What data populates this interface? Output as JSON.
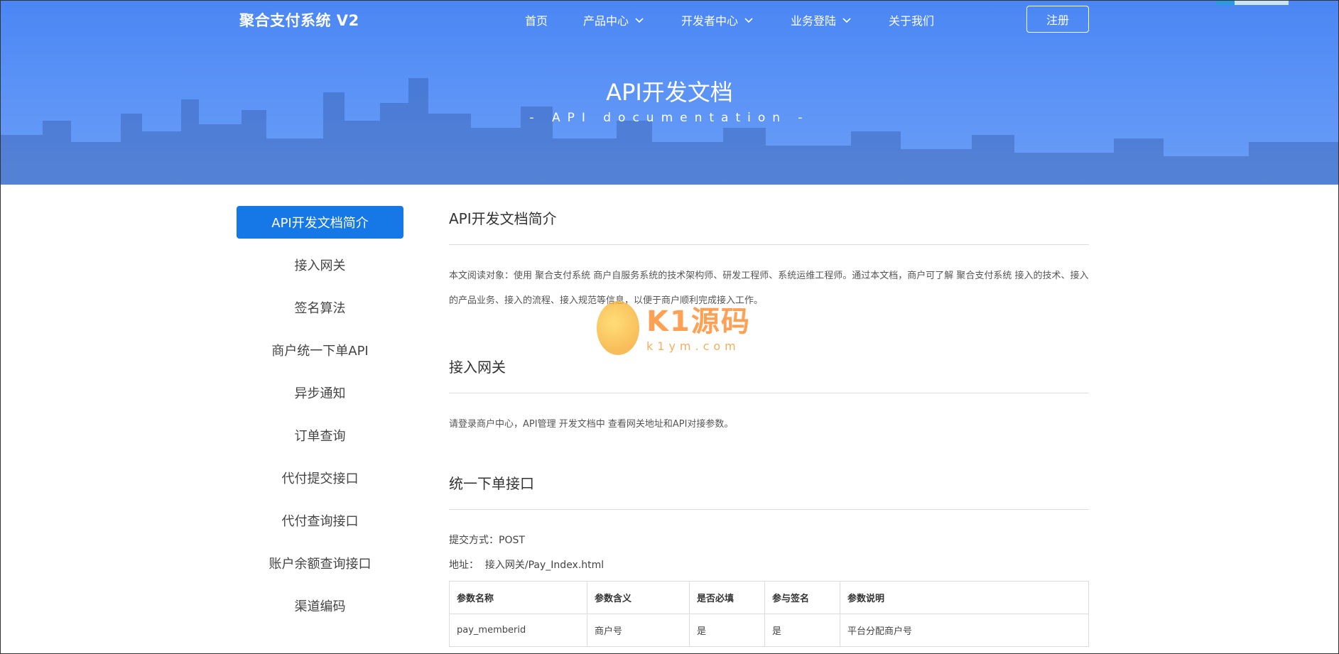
{
  "header": {
    "logo": "聚合支付系统 V2",
    "nav": [
      {
        "label": "首页",
        "has_dropdown": false
      },
      {
        "label": "产品中心",
        "has_dropdown": true
      },
      {
        "label": "开发者中心",
        "has_dropdown": true
      },
      {
        "label": "业务登陆",
        "has_dropdown": true
      },
      {
        "label": "关于我们",
        "has_dropdown": false
      }
    ],
    "register_label": "注册"
  },
  "hero": {
    "title": "API开发文档",
    "subtitle": "- API documentation -"
  },
  "sidebar": {
    "items": [
      {
        "label": "API开发文档简介",
        "active": true
      },
      {
        "label": "接入网关",
        "active": false
      },
      {
        "label": "签名算法",
        "active": false
      },
      {
        "label": "商户统一下单API",
        "active": false
      },
      {
        "label": "异步通知",
        "active": false
      },
      {
        "label": "订单查询",
        "active": false
      },
      {
        "label": "代付提交接口",
        "active": false
      },
      {
        "label": "代付查询接口",
        "active": false
      },
      {
        "label": "账户余额查询接口",
        "active": false
      },
      {
        "label": "渠道编码",
        "active": false
      }
    ]
  },
  "main": {
    "sections": [
      {
        "title": "API开发文档简介",
        "text": "本文阅读对象：使用 聚合支付系统 商户自服务系统的技术架构师、研发工程师、系统运维工程师。通过本文档，商户可了解 聚合支付系统 接入的技术、接入的产品业务、接入的流程、接入规范等信息，以便于商户顺利完成接入工作。"
      },
      {
        "title": "接入网关",
        "text": "请登录商户中心，API管理 开发文档中 查看网关地址和API对接参数。"
      },
      {
        "title": "统一下单接口",
        "method_label": "提交方式：",
        "method_value": "POST",
        "address_label": "地址：",
        "address_value": "接入网关/Pay_Index.html",
        "table": {
          "headers": [
            "参数名称",
            "参数含义",
            "是否必填",
            "参与签名",
            "参数说明"
          ],
          "rows": [
            [
              "pay_memberid",
              "商户号",
              "是",
              "是",
              "平台分配商户号"
            ]
          ]
        }
      }
    ]
  },
  "watermark": {
    "text": "K1源码",
    "sub": "k1ym.com"
  },
  "colors": {
    "hero_blue": "#4a86f4",
    "active_blue": "#1677e6"
  }
}
